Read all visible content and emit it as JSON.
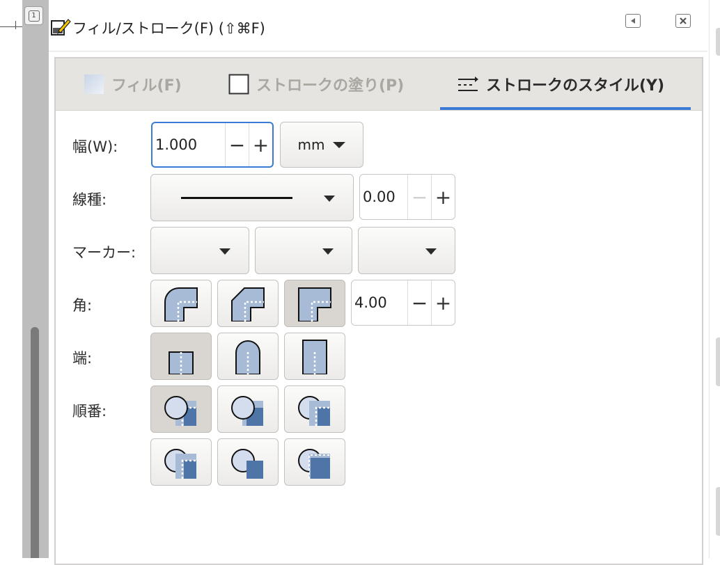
{
  "dialog": {
    "title": "フィル/ストローク(F) (⇧⌘F)",
    "icon": "fill-stroke-icon",
    "collapse_icon": "collapse-left-icon",
    "close_icon": "close-icon"
  },
  "canvas": {
    "page_button_label": "1"
  },
  "tabs": [
    {
      "label": "フィル(F)",
      "icon": "flat-fill-icon",
      "active": false
    },
    {
      "label": "ストロークの塗り(P)",
      "icon": "stroke-paint-icon",
      "active": false
    },
    {
      "label": "ストロークのスタイル(Y)",
      "icon": "stroke-style-icon",
      "active": true
    }
  ],
  "stroke_style": {
    "width": {
      "label": "幅(W):",
      "value": "1.000",
      "unit": "mm"
    },
    "dash": {
      "label": "線種:",
      "offset": "0.00"
    },
    "markers": {
      "label": "マーカー:"
    },
    "join": {
      "label": "角:",
      "miter_limit": "4.00",
      "options": [
        "round-join",
        "bevel-join",
        "miter-join"
      ],
      "selected": "miter-join"
    },
    "cap": {
      "label": "端:",
      "options": [
        "butt-cap",
        "round-cap",
        "square-cap"
      ],
      "selected": "butt-cap"
    },
    "order": {
      "label": "順番:",
      "selected_index": 0
    }
  },
  "colors": {
    "accent": "#3a7bd5",
    "shape_fill": "#a7bbd6",
    "shape_dark": "#4f74a8",
    "marker_fill": "#d3dded"
  }
}
